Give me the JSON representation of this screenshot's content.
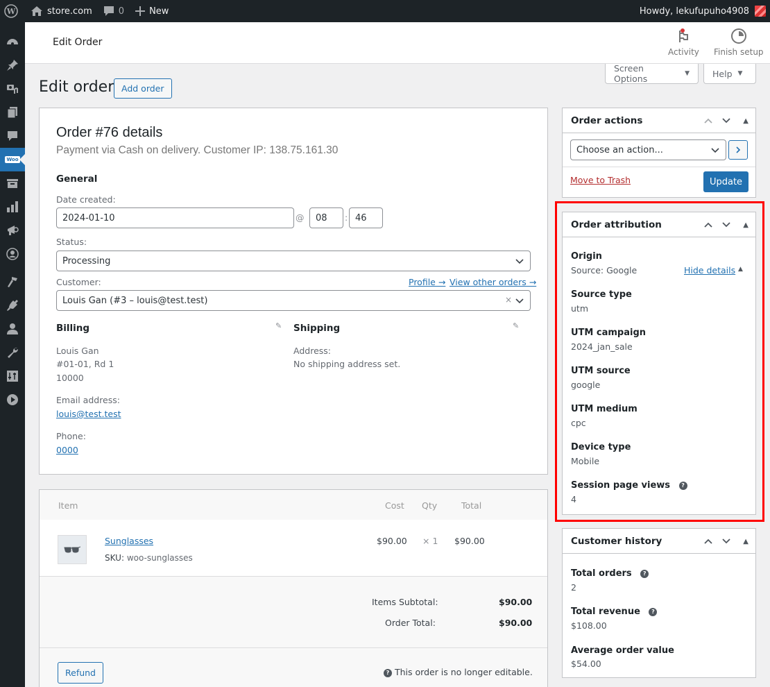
{
  "admin_bar": {
    "site_name": "store.com",
    "comments_count": "0",
    "new_label": "New",
    "greeting": "Howdy, lekufupuho4908"
  },
  "sidebar": {
    "items": [
      {
        "icon": "dashboard-icon"
      },
      {
        "icon": "pin-icon"
      },
      {
        "icon": "media-icon"
      },
      {
        "icon": "pages-icon"
      },
      {
        "icon": "comments-icon"
      },
      {
        "icon": "woocommerce-icon",
        "label": "woo",
        "active": true
      },
      {
        "icon": "products-icon"
      },
      {
        "icon": "analytics-icon"
      },
      {
        "icon": "marketing-icon"
      },
      {
        "icon": "account-icon"
      },
      {
        "icon": "appearance-icon"
      },
      {
        "icon": "plugins-icon"
      },
      {
        "icon": "users-icon"
      },
      {
        "icon": "tools-icon"
      },
      {
        "icon": "settings-icon"
      },
      {
        "icon": "play-icon"
      }
    ]
  },
  "wc_header": {
    "title": "Edit Order",
    "activity_label": "Activity",
    "finish_setup_label": "Finish setup"
  },
  "screen_options_label": "Screen Options",
  "help_label": "Help",
  "page": {
    "title": "Edit order",
    "add_order_label": "Add order"
  },
  "order": {
    "heading": "Order #76 details",
    "meta": "Payment via Cash on delivery. Customer IP: 138.75.161.30",
    "general_heading": "General",
    "date_label": "Date created:",
    "date_value": "2024-01-10",
    "at_sign": "@",
    "hour": "08",
    "minute": "46",
    "time_sep": ":",
    "status_label": "Status:",
    "status_value": "Processing",
    "customer_label": "Customer:",
    "profile_link": "Profile →",
    "other_orders_link": "View other orders →",
    "customer_value": "Louis Gan (#3 – louis@test.test)",
    "clear_symbol": "×",
    "billing": {
      "heading": "Billing",
      "name": "Louis Gan",
      "address1": "#01-01, Rd 1",
      "postcode": "10000",
      "email_label": "Email address:",
      "email": "louis@test.test",
      "phone_label": "Phone:",
      "phone": "0000"
    },
    "shipping": {
      "heading": "Shipping",
      "address_label": "Address:",
      "address_value": "No shipping address set."
    }
  },
  "items": {
    "columns": [
      "Item",
      "Cost",
      "Qty",
      "Total"
    ],
    "rows": [
      {
        "name": "Sunglasses",
        "sku_label": "SKU:",
        "sku": "woo-sunglasses",
        "cost": "$90.00",
        "qty": "× 1",
        "total": "$90.00"
      }
    ],
    "subtotal_label": "Items Subtotal:",
    "subtotal_value": "$90.00",
    "order_total_label": "Order Total:",
    "order_total_value": "$90.00",
    "refund_label": "Refund",
    "not_editable": "This order is no longer editable."
  },
  "order_actions": {
    "title": "Order actions",
    "select_placeholder": "Choose an action...",
    "trash_label": "Move to Trash",
    "update_label": "Update"
  },
  "order_attribution": {
    "title": "Order attribution",
    "hide_details": "Hide details",
    "fields": [
      {
        "label": "Origin",
        "value": "Source: Google"
      },
      {
        "label": "Source type",
        "value": "utm"
      },
      {
        "label": "UTM campaign",
        "value": "2024_jan_sale"
      },
      {
        "label": "UTM source",
        "value": "google"
      },
      {
        "label": "UTM medium",
        "value": "cpc"
      },
      {
        "label": "Device type",
        "value": "Mobile"
      },
      {
        "label": "Session page views",
        "value": "4"
      }
    ]
  },
  "customer_history": {
    "title": "Customer history",
    "fields": [
      {
        "label": "Total orders",
        "value": "2"
      },
      {
        "label": "Total revenue",
        "value": "$108.00"
      },
      {
        "label": "Average order value",
        "value": "$54.00"
      }
    ]
  },
  "colors": {
    "accent": "#2271b1",
    "admin_bar": "#1d2327",
    "danger": "#b32d2e",
    "highlight": "#ff0000"
  }
}
